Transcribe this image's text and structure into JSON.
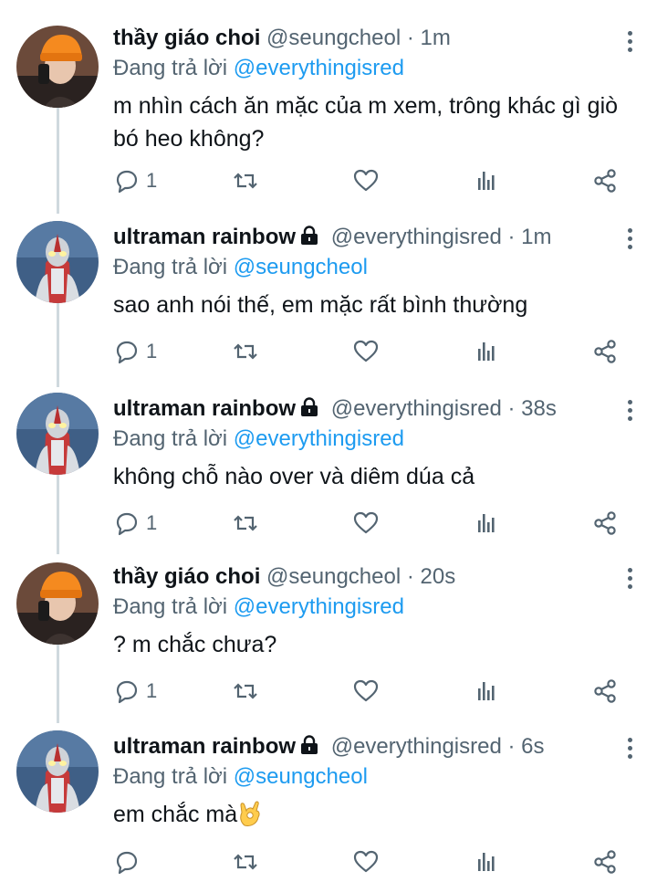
{
  "tweets": [
    {
      "name": "thầy giáo choi",
      "locked": false,
      "handle": "@seungcheol",
      "dot": "·",
      "time": "1m",
      "replying_prefix": "Đang trả lời",
      "replying_to": "@everythingisred",
      "text": "m nhìn cách ăn mặc của m xem, trông khác gì giò bó heo không?",
      "reply_count": "1",
      "avatar": "orange-beanie-avatar"
    },
    {
      "name": "ultraman rainbow",
      "locked": true,
      "handle": "@everythingisred",
      "dot": "·",
      "time": "1m",
      "replying_prefix": "Đang trả lời",
      "replying_to": "@seungcheol",
      "text": "sao anh nói thế, em mặc rất bình thường",
      "reply_count": "1",
      "avatar": "ultraman-avatar"
    },
    {
      "name": "ultraman rainbow",
      "locked": true,
      "handle": "@everythingisred",
      "dot": "·",
      "time": "38s",
      "replying_prefix": "Đang trả lời",
      "replying_to": "@everythingisred",
      "text": "không chỗ nào over và diêm dúa cả",
      "reply_count": "1",
      "avatar": "ultraman-avatar"
    },
    {
      "name": "thầy giáo choi",
      "locked": false,
      "handle": "@seungcheol",
      "dot": "·",
      "time": "20s",
      "replying_prefix": "Đang trả lời",
      "replying_to": "@everythingisred",
      "text": "? m chắc chưa?",
      "reply_count": "1",
      "avatar": "orange-beanie-avatar"
    },
    {
      "name": "ultraman rainbow",
      "locked": true,
      "handle": "@everythingisred",
      "dot": "·",
      "time": "6s",
      "replying_prefix": "Đang trả lời",
      "replying_to": "@seungcheol",
      "text": "em chắc mà",
      "reply_count": "",
      "avatar": "ultraman-avatar",
      "emoji": "ok-hand-emoji"
    }
  ],
  "icons": {
    "reply": "reply-icon",
    "retweet": "retweet-icon",
    "like": "like-icon",
    "stats": "stats-icon",
    "share": "share-icon",
    "more": "more-icon",
    "lock": "lock-icon"
  },
  "colors": {
    "mention": "#1d9bf0",
    "secondary": "#536471",
    "thread_line": "#cfd9de"
  }
}
